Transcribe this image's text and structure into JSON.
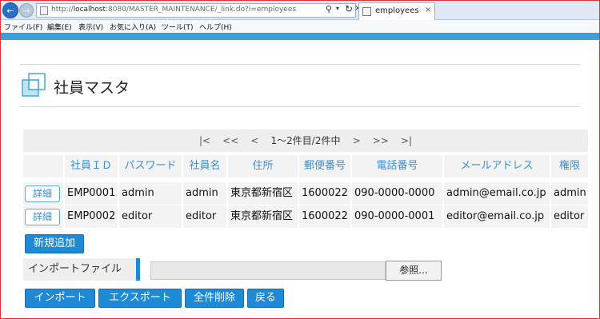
{
  "browser": {
    "address_prefix": "http://",
    "address_host": "localhost",
    "address_rest": ":8080/MASTER_MAINTENANCE/_link.do?i=employees",
    "tab_title": "employees",
    "back_glyph": "←",
    "forward_glyph": "→",
    "menu": [
      "ファイル(F)",
      "編集(E)",
      "表示(V)",
      "お気に入り(A)",
      "ツール(T)",
      "ヘルプ(H)"
    ]
  },
  "colors": {
    "accent": "#1e8ad6",
    "band": "#3aa0da",
    "header_text": "#3a8fd2",
    "row_bg": "#f3f3f3"
  },
  "page": {
    "title": "社員マスタ"
  },
  "pager": {
    "first": "|<",
    "prev_page": "<<",
    "prev": "<",
    "status": "1〜2件目/2件中",
    "next": ">",
    "next_page": ">>",
    "last": ">|"
  },
  "table": {
    "columns": [
      "社員ＩＤ",
      "パスワード",
      "社員名",
      "住所",
      "郵便番号",
      "電話番号",
      "メールアドレス",
      "権限"
    ],
    "detail_label": "詳細",
    "rows": [
      [
        "EMP0001",
        "admin",
        "admin",
        "東京都新宿区",
        "1600022",
        "090-0000-0000",
        "admin@email.co.jp",
        "admin"
      ],
      [
        "EMP0002",
        "editor",
        "editor",
        "東京都新宿区",
        "1600022",
        "090-0000-0001",
        "editor@email.co.jp",
        "editor"
      ]
    ]
  },
  "actions": {
    "add_new": "新規追加",
    "import_file_label": "インポートファイル",
    "browse": "参照...",
    "import": "インポート",
    "export": "エクスポート",
    "delete_all": "全件削除",
    "back": "戻る"
  }
}
